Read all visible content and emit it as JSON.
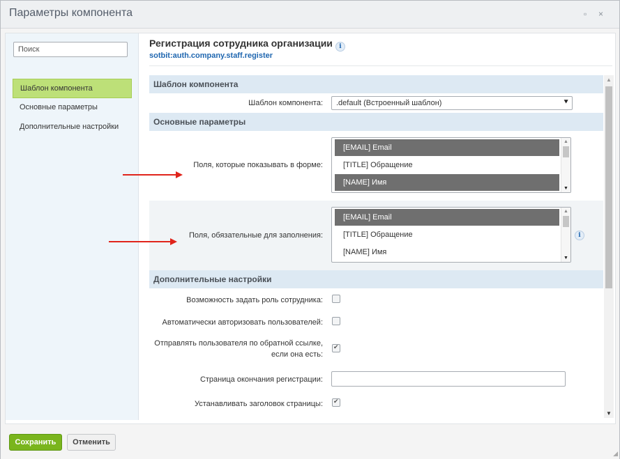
{
  "dialog": {
    "title": "Параметры компонента",
    "minimize_glyph": "▫",
    "close_glyph": "×"
  },
  "sidebar": {
    "search_placeholder": "Поиск",
    "items": [
      {
        "label": "Шаблон компонента",
        "active": true
      },
      {
        "label": "Основные параметры",
        "active": false
      },
      {
        "label": "Дополнительные настройки",
        "active": false
      }
    ]
  },
  "header": {
    "title": "Регистрация сотрудника организации",
    "subtitle": "sotbit:auth.company.staff.register",
    "info_glyph": "i"
  },
  "sections": {
    "template": {
      "title": "Шаблон компонента",
      "template_label": "Шаблон компонента:",
      "template_value": ".default (Встроенный шаблон)"
    },
    "main": {
      "title": "Основные параметры",
      "show_fields_label": "Поля, которые показывать в форме:",
      "show_fields_options": [
        "[EMAIL] Email",
        "[TITLE] Обращение",
        "[NAME] Имя"
      ],
      "required_fields_label": "Поля, обязательные для заполнения:",
      "required_fields_options": [
        "[EMAIL] Email",
        "[TITLE] Обращение",
        "[NAME] Имя"
      ]
    },
    "extra": {
      "title": "Дополнительные настройки",
      "role_label": "Возможность задать роль сотрудника:",
      "role_checked": false,
      "auto_auth_label": "Автоматически авторизовать пользователей:",
      "auto_auth_checked": false,
      "back_url_label_1": "Отправлять пользователя по обратной ссылке,",
      "back_url_label_2": "если она есть:",
      "back_url_checked": true,
      "finish_page_label": "Страница окончания регистрации:",
      "finish_page_value": "",
      "set_title_label": "Устанавливать заголовок страницы:",
      "set_title_checked": true
    }
  },
  "footer": {
    "save_label": "Сохранить",
    "cancel_label": "Отменить"
  },
  "colors": {
    "accent_green": "#7ab51d",
    "annotation_red": "#e0241b",
    "section_blue": "#dde9f3",
    "link_blue": "#2067b0"
  }
}
